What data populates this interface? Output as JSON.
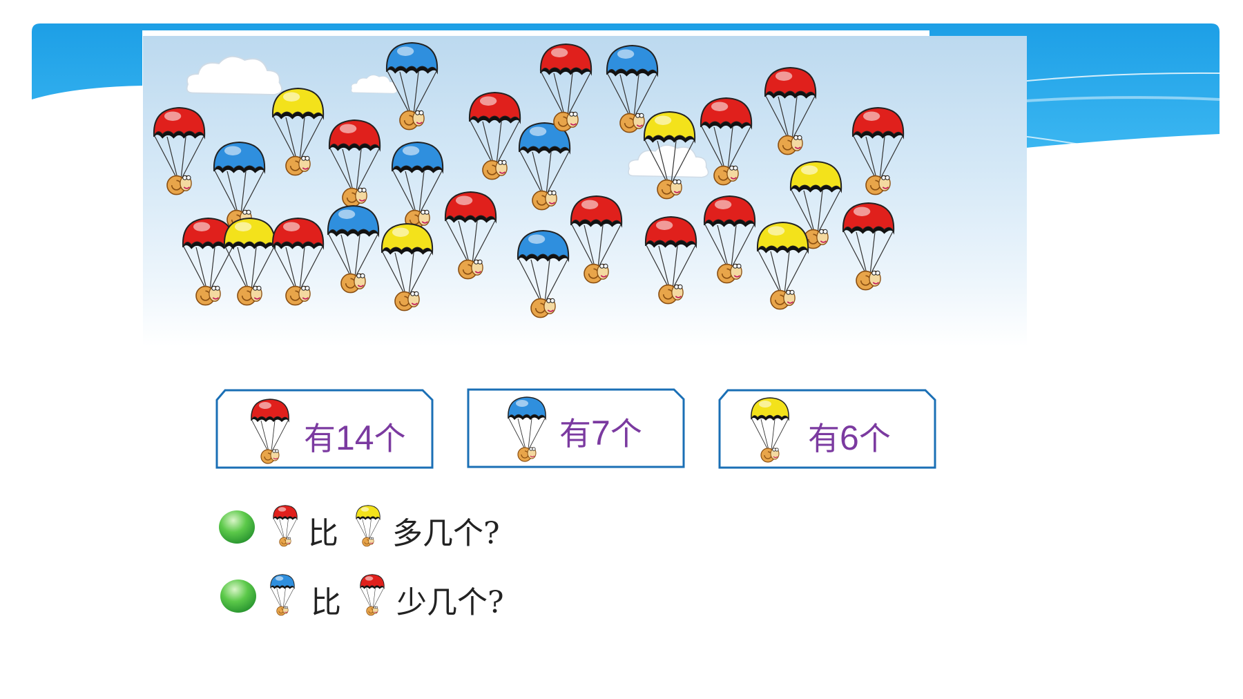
{
  "colors": {
    "banner": "#1fa3e8",
    "red": "#e0201c",
    "blue": "#2f8fde",
    "yellow": "#f3e21b",
    "box_border": "#1a6fb5",
    "count_text": "#7b3aa0",
    "bullet": "#2ea83a"
  },
  "counts": [
    {
      "color": "red",
      "prefix": "有",
      "number": "14",
      "suffix": "个"
    },
    {
      "color": "blue",
      "prefix": "有",
      "number": "7",
      "suffix": "个"
    },
    {
      "color": "yellow",
      "prefix": "有",
      "number": "6",
      "suffix": "个"
    }
  ],
  "questions": [
    {
      "first": "red",
      "word": "比",
      "second": "yellow",
      "tail": "多几个?"
    },
    {
      "first": "blue",
      "word": "比",
      "second": "red",
      "tail": "少几个?"
    }
  ]
}
